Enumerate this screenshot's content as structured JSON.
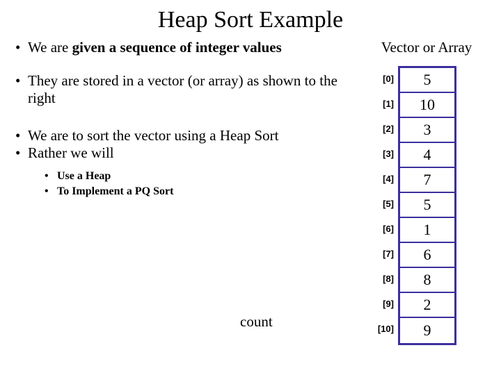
{
  "title": "Heap Sort Example",
  "bullets": {
    "b1_pre": "We are ",
    "b1_bold": "given a sequence of integer values",
    "b2": "They are stored in a vector (or array) as shown to the right",
    "b3": "We are to sort the vector using a Heap Sort",
    "b4": "Rather we will",
    "s1": "Use a Heap",
    "s2": "To Implement a PQ Sort"
  },
  "array_label": "Vector or Array",
  "count_label": "count",
  "array": {
    "indices": [
      "[0]",
      "[1]",
      "[2]",
      "[3]",
      "[4]",
      "[5]",
      "[6]",
      "[7]",
      "[8]",
      "[9]",
      "[10]"
    ],
    "values": [
      "5",
      "10",
      "3",
      "4",
      "7",
      "5",
      "1",
      "6",
      "8",
      "2",
      "9"
    ]
  }
}
